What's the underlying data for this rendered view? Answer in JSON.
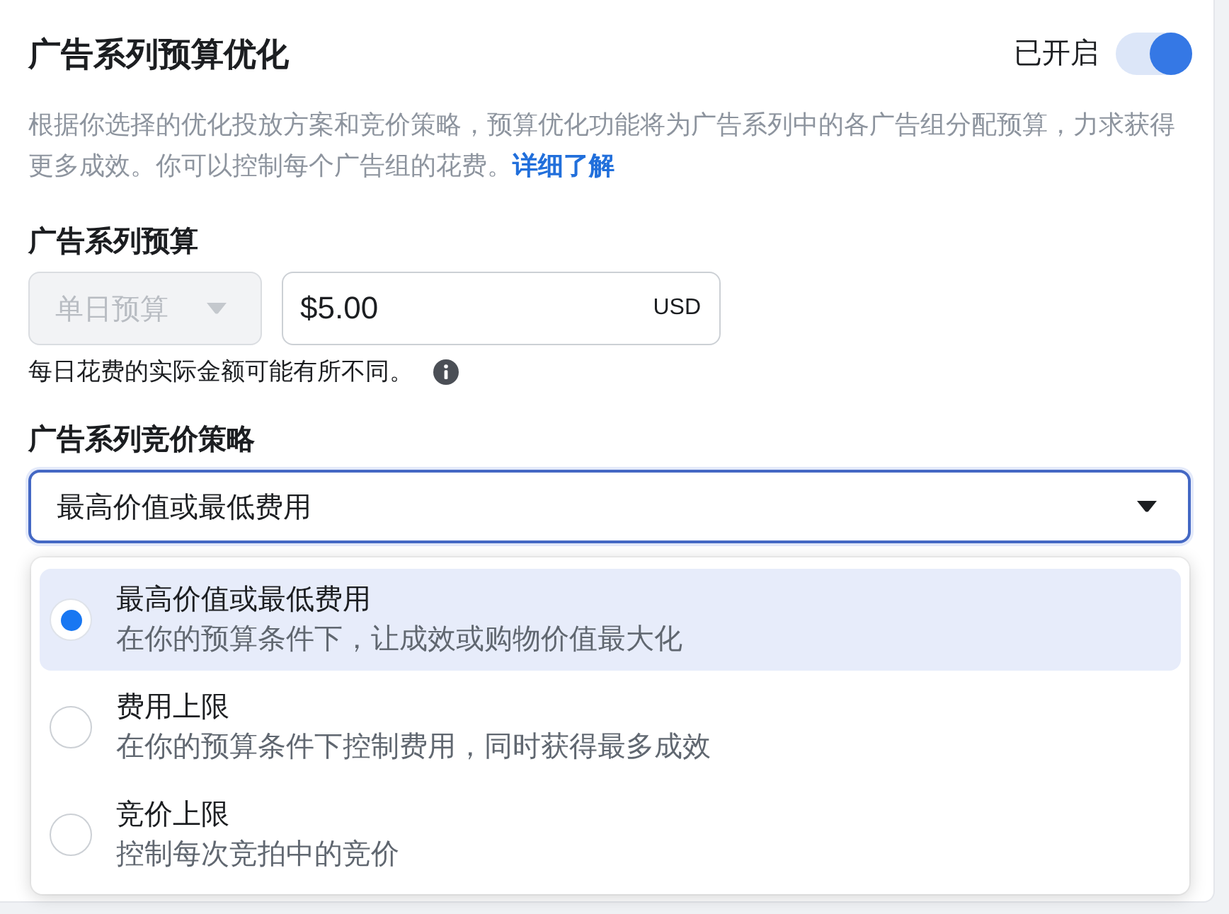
{
  "section": {
    "title": "广告系列预算优化",
    "status_label": "已开启",
    "toggle": {
      "on": true
    },
    "description": "根据你选择的优化投放方案和竞价策略，预算优化功能将为广告系列中的各广告组分配预算，力求获得更多成效。你可以控制每个广告组的花费。",
    "learn_more_link": "详细了解"
  },
  "budget": {
    "label": "广告系列预算",
    "type_select": {
      "value": "单日预算",
      "disabled": true
    },
    "amount_field": {
      "value": "$5.00",
      "currency": "USD"
    },
    "note": "每日花费的实际金额可能有所不同。"
  },
  "bid_strategy": {
    "label": "广告系列竞价策略",
    "select": {
      "value": "最高价值或最低费用",
      "expanded": true
    },
    "options": [
      {
        "title": "最高价值或最低费用",
        "description": "在你的预算条件下，让成效或购物价值最大化",
        "selected": true
      },
      {
        "title": "费用上限",
        "description": "在你的预算条件下控制费用，同时获得最多成效",
        "selected": false
      },
      {
        "title": "竞价上限",
        "description": "控制每次竞拍中的竞价",
        "selected": false
      }
    ]
  }
}
